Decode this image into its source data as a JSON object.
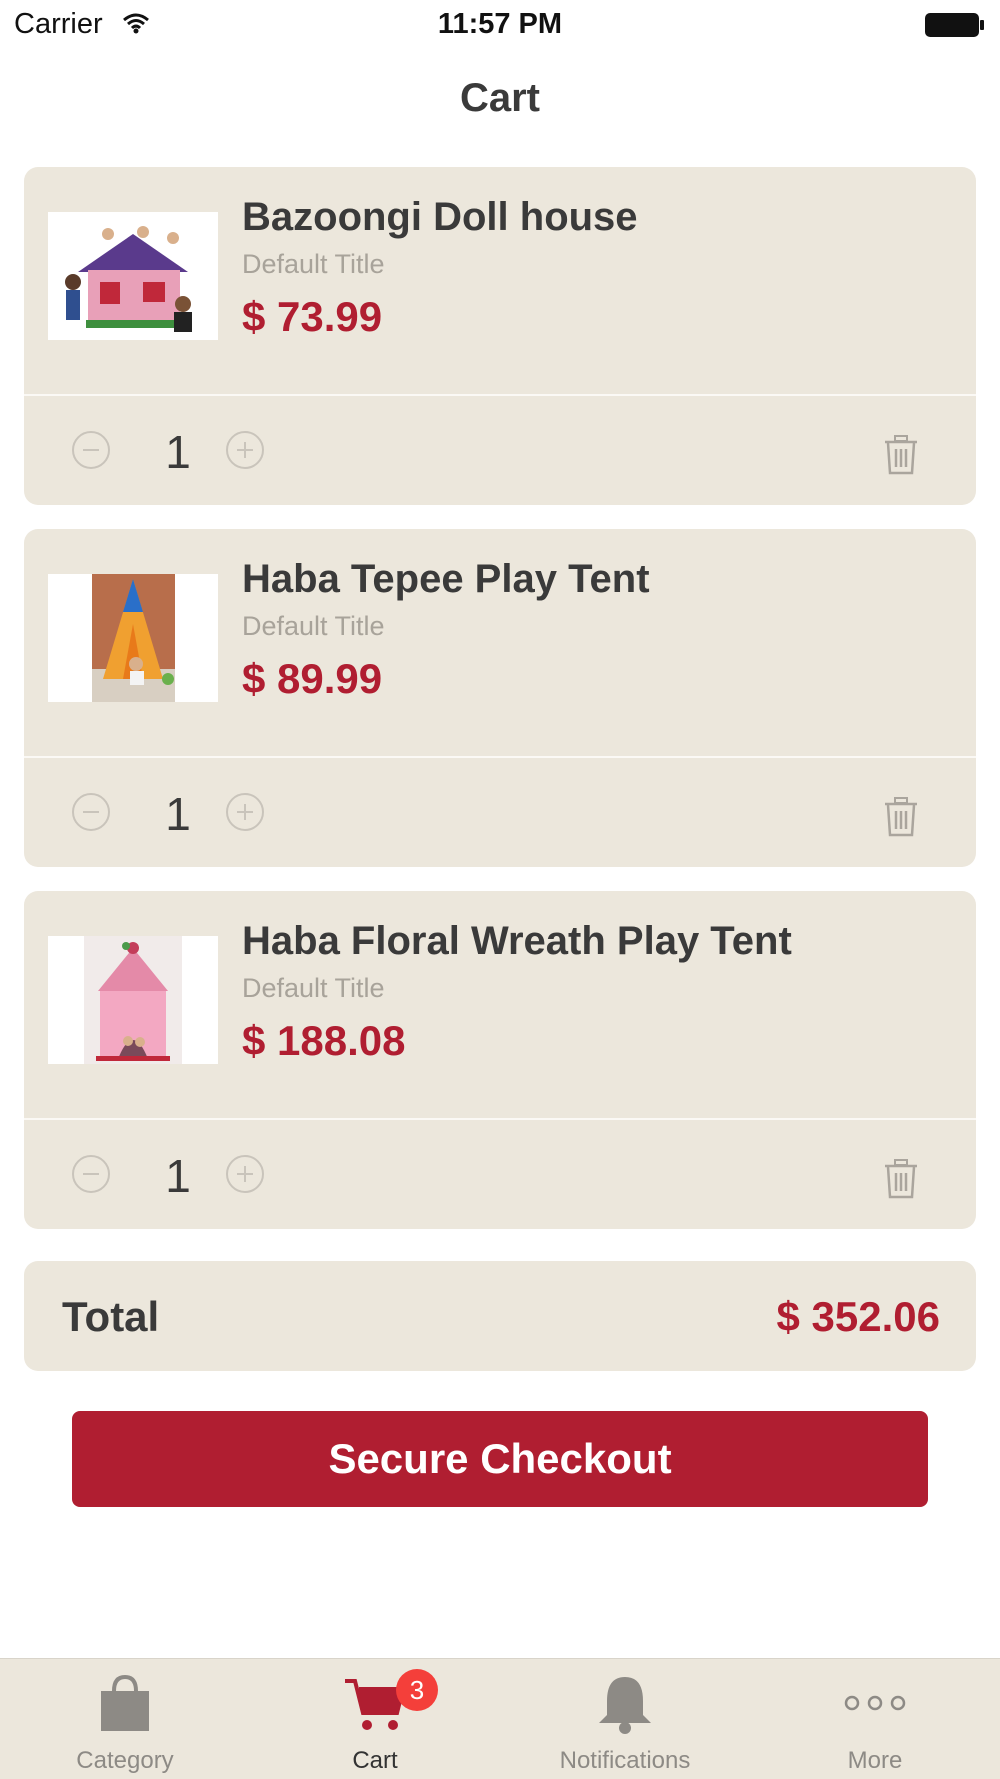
{
  "status_bar": {
    "carrier": "Carrier",
    "time": "11:57 PM"
  },
  "nav": {
    "title": "Cart"
  },
  "cart": {
    "items": [
      {
        "name": "Bazoongi Doll house",
        "variant": "Default Title",
        "price": "$ 73.99",
        "quantity": "1"
      },
      {
        "name": "Haba Tepee Play Tent",
        "variant": "Default Title",
        "price": "$ 89.99",
        "quantity": "1"
      },
      {
        "name": "Haba Floral Wreath Play Tent",
        "variant": "Default Title",
        "price": "$ 188.08",
        "quantity": "1"
      }
    ],
    "total_label": "Total",
    "total_value": "$ 352.06",
    "checkout_label": "Secure Checkout"
  },
  "tabbar": {
    "tabs": [
      {
        "label": "Category",
        "icon": "shopping-bag-icon",
        "active": false
      },
      {
        "label": "Cart",
        "icon": "cart-icon",
        "active": true,
        "badge": "3"
      },
      {
        "label": "Notifications",
        "icon": "bell-icon",
        "active": false
      },
      {
        "label": "More",
        "icon": "more-dots-icon",
        "active": false
      }
    ]
  },
  "colors": {
    "accent": "#b01e31",
    "card_bg": "#ece7dc",
    "badge": "#f43f3a"
  }
}
